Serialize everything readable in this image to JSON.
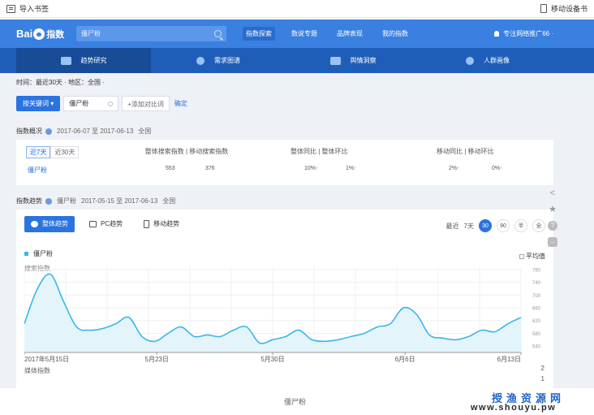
{
  "browser": {
    "import_bookmarks": "导入书签",
    "mobile_bookmarks": "移动设备书"
  },
  "header": {
    "logo_text": "Bai",
    "logo_suffix": "指数",
    "search_value": "僵尸粉",
    "nav": [
      "指数探索",
      "数说专题",
      "品牌表现",
      "我的指数"
    ],
    "nav_active": 0,
    "user": "专注网络推广66"
  },
  "subnav": {
    "items": [
      "趋势研究",
      "需求图谱",
      "舆情洞察",
      "人群画像"
    ],
    "active": 0
  },
  "filter": {
    "text": "时间：最近30天 · 地区：全国 ·"
  },
  "keyword_bar": {
    "mode_button": "按关键词",
    "keyword": "僵尸粉",
    "add_compare": "+添加对比词",
    "confirm": "确定"
  },
  "overview": {
    "title": "指数概况",
    "date_range": "2017-06-07 至 2017-06-13",
    "region": "全国",
    "tabs": [
      "近7天",
      "近30天"
    ],
    "tab_active": 0,
    "col_search": "整体搜索指数 | 移动搜索指数",
    "col_yoy": "整体同比 | 整体环比",
    "col_mobile": "移动同比 | 移动环比",
    "row_keyword": "僵尸粉",
    "total_index": "553",
    "mobile_index": "376",
    "yoy": "10%",
    "mom": "1%",
    "mobile_yoy": "2%",
    "mobile_mom": "0%"
  },
  "trend": {
    "title": "指数趋势",
    "keyword": "僵尸粉",
    "date_range": "2017-05-15 至 2017-06-13",
    "region": "全国",
    "tabs": [
      "整体趋势",
      "PC趋势",
      "移动趋势"
    ],
    "tab_active": 0,
    "range_label": "最近",
    "ranges": [
      "7天",
      "30",
      "90",
      "半",
      "全"
    ],
    "range_active": 1,
    "legend": "僵尸粉",
    "avg_label": "平均值",
    "y_label": "搜索指数",
    "media_label": "媒体指数",
    "media_max": "2",
    "media_min": "1"
  },
  "caption": "僵尸粉",
  "watermark": {
    "cn": "授渔资源网",
    "url": "www.shouyu.pw"
  },
  "colors": {
    "header_blue": "#3a80e0",
    "subnav_blue": "#1f5eb8",
    "series": "#3ab7e6"
  },
  "chart_data": {
    "type": "area",
    "series": [
      {
        "name": "僵尸粉",
        "values": [
          610,
          720,
          765,
          680,
          600,
          590,
          595,
          610,
          630,
          570,
          555,
          580,
          600,
          570,
          575,
          570,
          590,
          600,
          550,
          560,
          570,
          590,
          560,
          555,
          560,
          570,
          580,
          600,
          610,
          660,
          640,
          575,
          565,
          560,
          570,
          590,
          585,
          610,
          630
        ]
      }
    ],
    "x_tick_labels": [
      "2017年5月15日",
      "5月23日",
      "5月30日",
      "6月6日",
      "6月13日"
    ],
    "y_ticks": [
      540,
      580,
      620,
      660,
      700,
      740,
      780
    ],
    "ylim": [
      520,
      790
    ],
    "grid": true
  }
}
